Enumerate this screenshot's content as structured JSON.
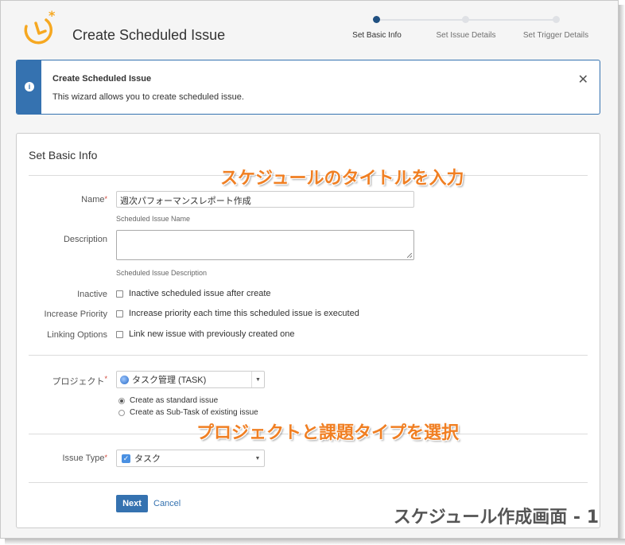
{
  "header": {
    "title": "Create Scheduled Issue",
    "steps": [
      {
        "label": "Set Basic Info",
        "active": true
      },
      {
        "label": "Set Issue Details",
        "active": false
      },
      {
        "label": "Set Trigger Details",
        "active": false
      }
    ]
  },
  "message": {
    "title": "Create Scheduled Issue",
    "body": "This wizard allows you to create scheduled issue.",
    "icon": "info-icon",
    "close_icon": "close-icon"
  },
  "form": {
    "section_title": "Set Basic Info",
    "name": {
      "label": "Name",
      "required": "*",
      "value": "週次パフォーマンスレポート作成",
      "hint": "Scheduled Issue Name"
    },
    "description": {
      "label": "Description",
      "value": "",
      "hint": "Scheduled Issue Description"
    },
    "inactive": {
      "label": "Inactive",
      "option": "Inactive scheduled issue after create"
    },
    "increase_priority": {
      "label": "Increase Priority",
      "option": "Increase priority each time this scheduled issue is executed"
    },
    "linking_options": {
      "label": "Linking Options",
      "option": "Link new issue with previously created one"
    },
    "project": {
      "label": "プロジェクト",
      "required": "*",
      "value": "タスク管理 (TASK)",
      "icon": "project-icon"
    },
    "create_as": {
      "standard": "Create as standard issue",
      "subtask": "Create as Sub-Task of existing issue",
      "selected": "standard"
    },
    "issue_type": {
      "label": "Issue Type",
      "required": "*",
      "value": "タスク",
      "icon": "task-checkbox-icon"
    },
    "next_label": "Next",
    "cancel_label": "Cancel"
  },
  "annotations": {
    "title_note": "スケジュールのタイトルを入力",
    "project_note": "プロジェクトと課題タイプを選択",
    "caption": "スケジュール作成画面 - 1"
  },
  "colors": {
    "accent": "#3572b0",
    "active_step": "#205081",
    "logo_orange": "#f6a821",
    "annotation_orange": "#f07f23",
    "required": "#d04437"
  }
}
